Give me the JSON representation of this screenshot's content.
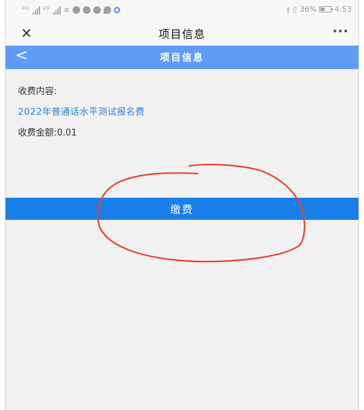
{
  "status_bar": {
    "net_label_1": "4G",
    "net_label_2": "2G",
    "battery_percent": "36%",
    "time": "4:53",
    "icons": [
      "signal-icon",
      "signal-icon",
      "wifi-icon",
      "notification-icon",
      "notification-icon",
      "notification-icon",
      "chat-icon",
      "app-icon",
      "vibrate-icon",
      "sim-icon",
      "battery-icon"
    ]
  },
  "title_bar": {
    "close_glyph": "✕",
    "title": "项目信息",
    "more_glyph": "···"
  },
  "page_header": {
    "back_glyph": "<",
    "title": "项目信息"
  },
  "content": {
    "fee_content_label": "收费内容:",
    "item_name": "2022年普通话水平测试报名费",
    "fee_amount": "收费金额:0.01"
  },
  "pay_button": {
    "label": "缴费"
  },
  "colors": {
    "header": "#5f9cf4",
    "button": "#1a7ee9",
    "link_text": "#2a7fd8",
    "annotation": "#e8412e"
  }
}
